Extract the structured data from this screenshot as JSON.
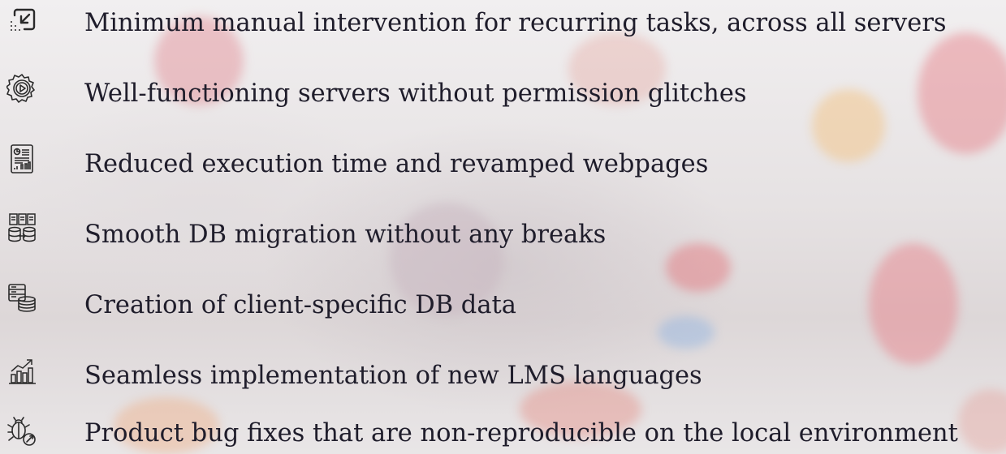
{
  "colors": {
    "text": "#1f1d2b",
    "icon": "#2a2a2a",
    "bokeh_red": "#e0455a",
    "bokeh_orange": "#f0a060",
    "bokeh_blue": "#7fb0e8"
  },
  "items": [
    {
      "icon": "minimize-arrow-icon",
      "label": "Minimum manual intervention for recurring tasks, across all servers"
    },
    {
      "icon": "gear-play-icon",
      "label": "Well-functioning servers without permission glitches"
    },
    {
      "icon": "report-chart-icon",
      "label": "Reduced execution time and revamped webpages"
    },
    {
      "icon": "database-migration-icon",
      "label": "Smooth DB migration without any breaks"
    },
    {
      "icon": "database-stack-icon",
      "label": "Creation of client-specific DB data"
    },
    {
      "icon": "growth-chart-icon",
      "label": "Seamless implementation of new LMS languages"
    },
    {
      "icon": "bug-fix-icon",
      "label": "Product bug fixes that are non-reproducible on the local environment"
    }
  ]
}
